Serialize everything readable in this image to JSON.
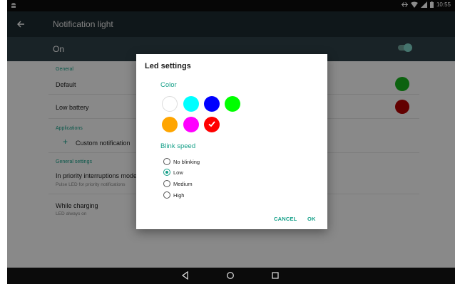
{
  "status_bar": {
    "time": "10:55",
    "notification_icon": "android-debug-icon",
    "icons": [
      "sync-icon",
      "wifi-icon",
      "signal-icon",
      "battery-icon"
    ]
  },
  "toolbar": {
    "back_icon": "arrow-back-icon",
    "title": "Notification light"
  },
  "master_switch": {
    "label": "On",
    "enabled": true
  },
  "settings": {
    "general_header": "General",
    "default_label": "Default",
    "default_color": "#17b21c",
    "low_battery_label": "Low battery",
    "low_battery_color": "#b30000",
    "applications_header": "Applications",
    "custom_notification_label": "Custom notification",
    "general_settings_header": "General settings",
    "priority_title": "In priority interruptions mode",
    "priority_subtitle": "Pulse LED for priority notifications",
    "while_charging_title": "While charging",
    "while_charging_subtitle": "LED always on"
  },
  "dialog": {
    "title": "Led settings",
    "color_label": "Color",
    "colors": [
      "#ffffff",
      "#00ffff",
      "#0000ff",
      "#00ff00",
      "#ffa500",
      "#ff00ff",
      "#ff0000"
    ],
    "selected_color": "#ff0000",
    "blink_label": "Blink speed",
    "blink_options": [
      "No blinking",
      "Low",
      "Medium",
      "High"
    ],
    "blink_selected": "Low",
    "cancel_label": "CANCEL",
    "ok_label": "OK"
  },
  "nav_bar": {
    "icons": [
      "back-triangle-icon",
      "home-circle-icon",
      "recents-square-icon"
    ]
  },
  "colors": {
    "accent": "#16a089",
    "toolbar": "#1c2a30",
    "switch_bar": "#2e4048"
  }
}
